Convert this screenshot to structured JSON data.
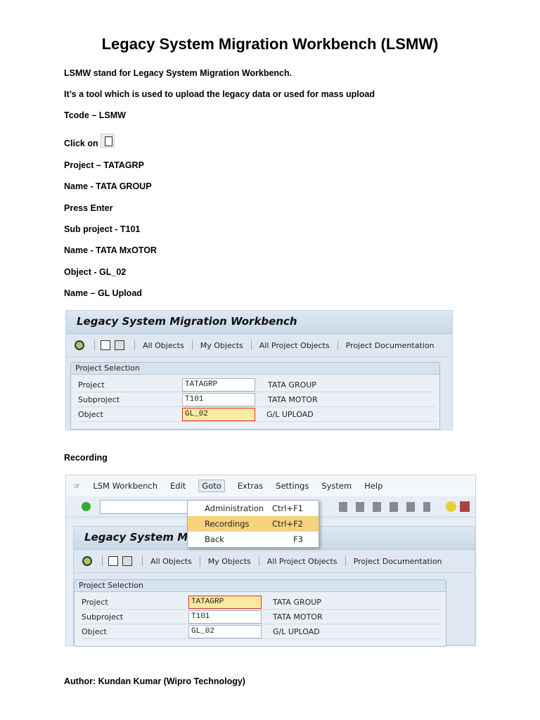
{
  "title": "Legacy System Migration Workbench (LSMW)",
  "lines": [
    "LSMW stand for Legacy System Migration Workbench.",
    "It’s a tool which is used to upload the legacy data or used for mass upload",
    "Tcode – LSMW",
    "Click on",
    "Project – TATAGRP",
    "Name - TATA GROUP",
    "Press Enter",
    "Sub project - T101",
    "Name - TATA MxOTOR",
    "Object - GL_02",
    "Name – GL Upload",
    "Recording"
  ],
  "author": "Author: Kundan Kumar (Wipro Technology)",
  "sap": {
    "header": "Legacy System Migration Workbench",
    "toolbar": [
      "All Objects",
      "My Objects",
      "All Project Objects",
      "Project Documentation"
    ],
    "group_title": "Project Selection",
    "fields": [
      {
        "label": "Project",
        "value": "TATAGRP",
        "desc": "TATA GROUP"
      },
      {
        "label": "Subproject",
        "value": "T101",
        "desc": "TATA MOTOR"
      },
      {
        "label": "Object",
        "value": "GL_02",
        "desc": "G/L UPLOAD"
      }
    ],
    "header2": "Legacy System Mi",
    "menu": [
      "LSM Workbench",
      "Edit",
      "Goto",
      "Extras",
      "Settings",
      "System",
      "Help"
    ],
    "dropdown": [
      {
        "label": "Administration",
        "key": "Ctrl+F1"
      },
      {
        "label": "Recordings",
        "key": "Ctrl+F2"
      },
      {
        "label": "Back",
        "key": "F3"
      }
    ]
  }
}
